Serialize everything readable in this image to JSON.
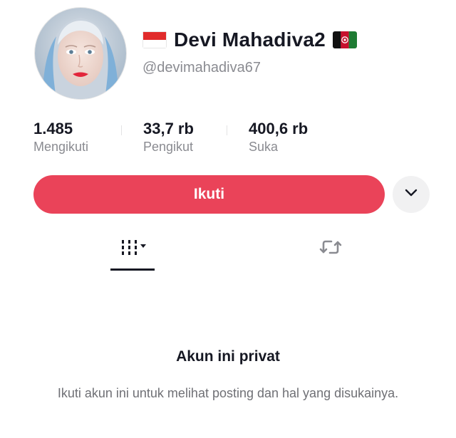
{
  "profile": {
    "display_name": "Devi Mahadiva2",
    "username": "@devimahadiva67",
    "flag_left": "flag-indonesia",
    "flag_right": "flag-afghanistan"
  },
  "stats": [
    {
      "value": "1.485",
      "label": "Mengikuti"
    },
    {
      "value": "33,7 rb",
      "label": "Pengikut"
    },
    {
      "value": "400,6 rb",
      "label": "Suka"
    }
  ],
  "actions": {
    "follow_label": "Ikuti",
    "more_icon": "chevron-down-icon"
  },
  "tabs": [
    {
      "icon": "grid-icon",
      "active": true
    },
    {
      "icon": "repost-icon",
      "active": false
    }
  ],
  "private_notice": {
    "title": "Akun ini privat",
    "description": "Ikuti akun ini untuk melihat posting dan hal yang disukainya."
  },
  "colors": {
    "accent": "#ea4359",
    "text_primary": "#161823",
    "text_secondary": "#8a8b91",
    "button_secondary": "#f1f1f2"
  }
}
